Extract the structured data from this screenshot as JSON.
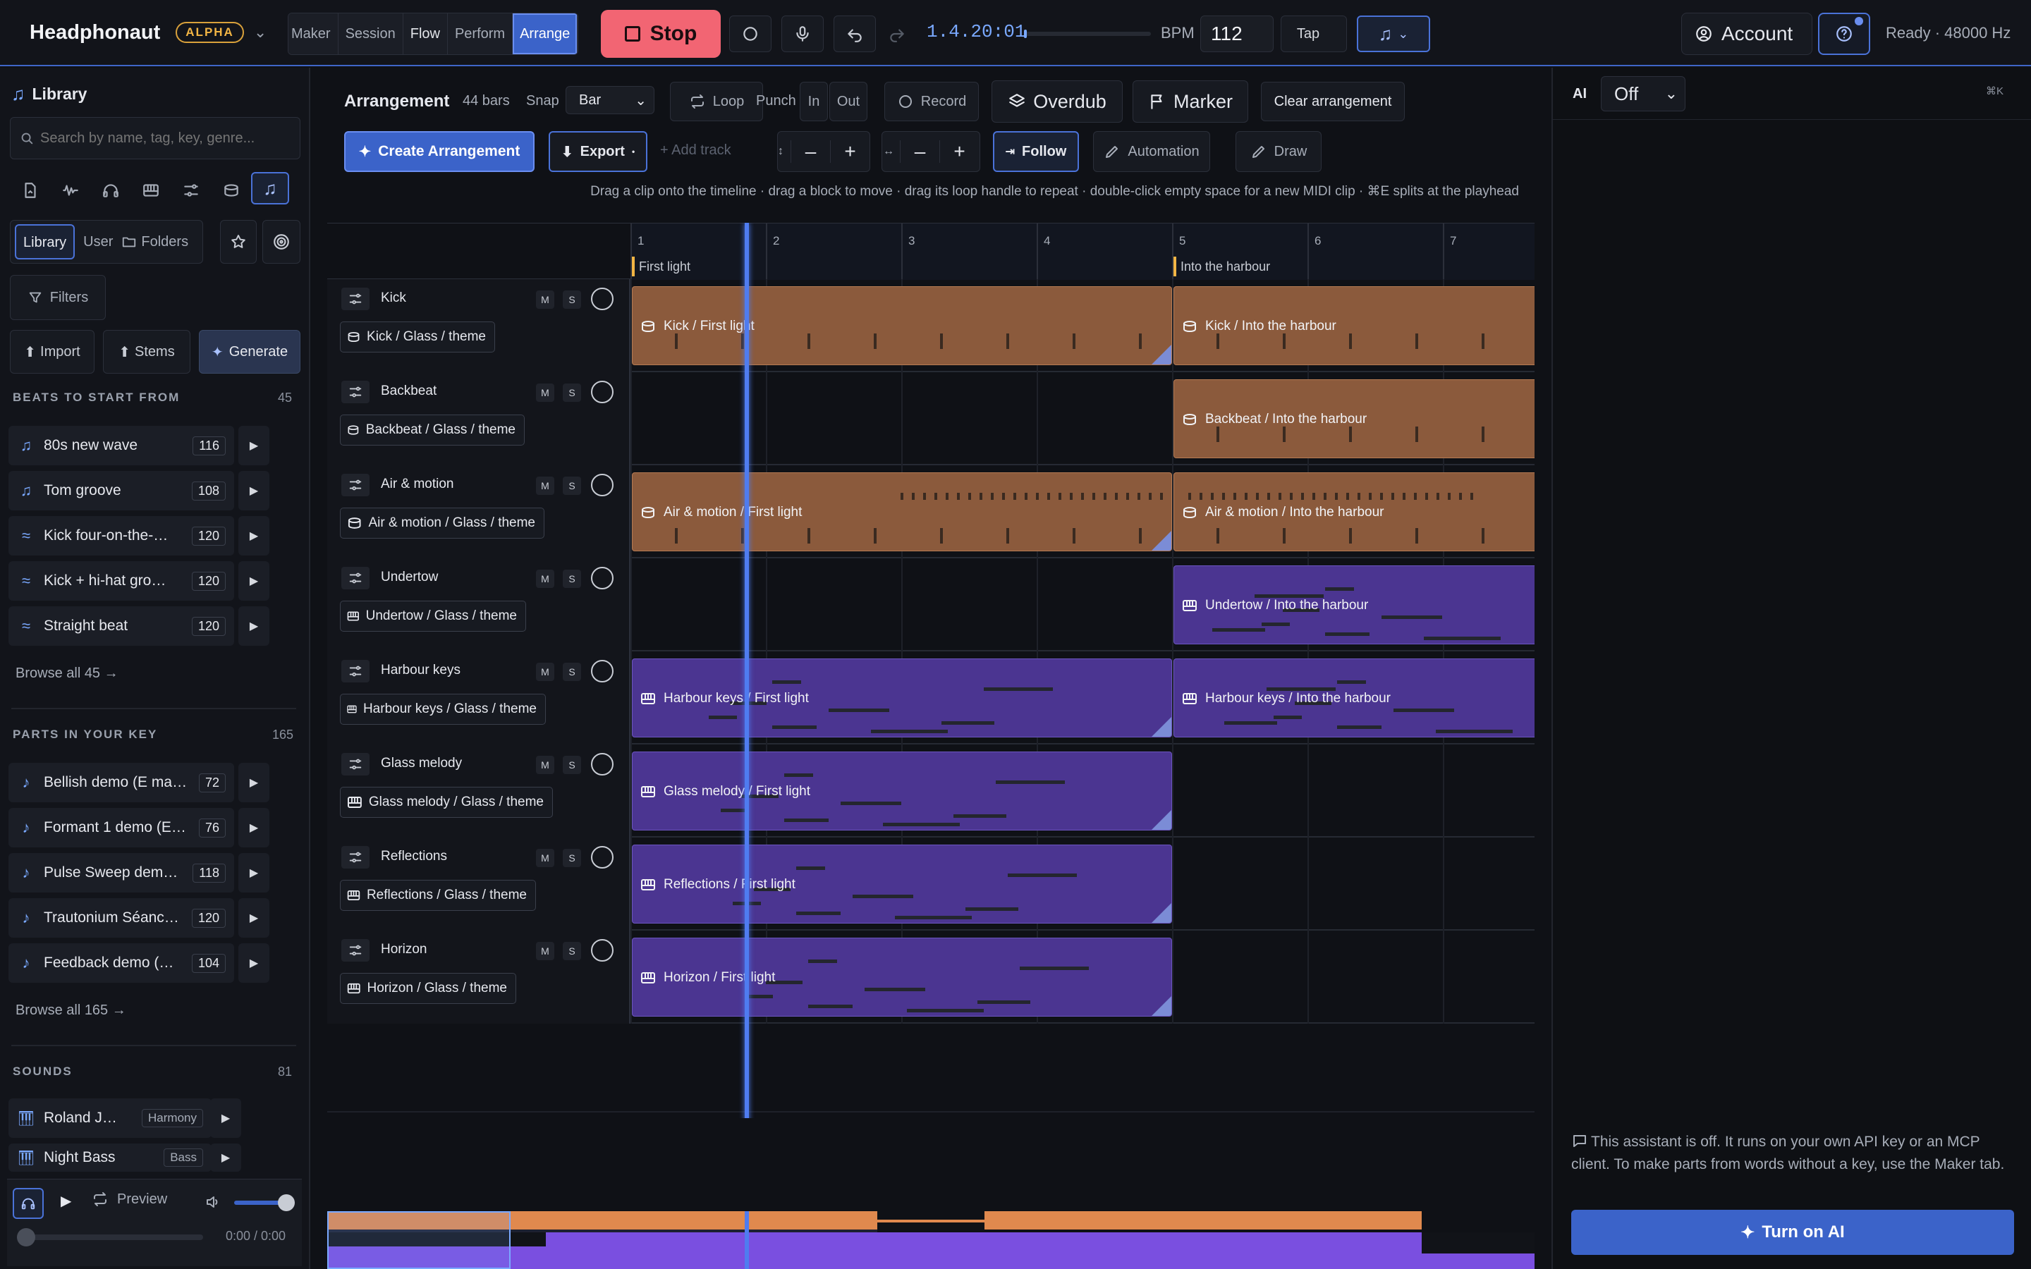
{
  "app": {
    "name": "Headphonaut",
    "badge": "ALPHA"
  },
  "modes": [
    "Maker",
    "Session",
    "Flow",
    "Perform",
    "Arrange"
  ],
  "active_mode": "Arrange",
  "transport": {
    "stop_label": "Stop",
    "timecode": "1.4.20:01",
    "bpm_label": "BPM",
    "bpm": "112",
    "tap_label": "Tap"
  },
  "account_label": "Account",
  "status": "Ready · 48000 Hz",
  "library": {
    "title": "Library",
    "search_placeholder": "Search by name, tag, key, genre...",
    "tabs": [
      "Library",
      "User",
      "Folders"
    ],
    "filters_label": "Filters",
    "import_label": "Import",
    "stems_label": "Stems",
    "generate_label": "Generate",
    "beats": {
      "title": "BEATS TO START FROM",
      "count": "45",
      "browse": "Browse all 45 →",
      "items": [
        {
          "name": "80s new wave",
          "bpm": "116",
          "icon": "note-icon"
        },
        {
          "name": "Tom groove",
          "bpm": "108",
          "icon": "note-icon"
        },
        {
          "name": "Kick four-on-the-…",
          "bpm": "120",
          "icon": "wave-icon"
        },
        {
          "name": "Kick + hi-hat gro…",
          "bpm": "120",
          "icon": "wave-icon"
        },
        {
          "name": "Straight beat",
          "bpm": "120",
          "icon": "wave-icon"
        }
      ]
    },
    "parts": {
      "title": "PARTS IN YOUR KEY",
      "count": "165",
      "browse": "Browse all 165 →",
      "items": [
        {
          "name": "Bellish demo (E ma…",
          "bpm": "72"
        },
        {
          "name": "Formant 1 demo (E…",
          "bpm": "76"
        },
        {
          "name": "Pulse Sweep dem…",
          "bpm": "118"
        },
        {
          "name": "Trautonium Séanc…",
          "bpm": "120"
        },
        {
          "name": "Feedback demo (…",
          "bpm": "104"
        }
      ]
    },
    "sounds": {
      "title": "SOUNDS",
      "count": "81",
      "items": [
        {
          "name": "Roland J…",
          "tag": "Harmony"
        },
        {
          "name": "Night Bass",
          "tag": "Bass"
        }
      ]
    },
    "preview_label": "Preview",
    "preview_time": "0:00 / 0:00"
  },
  "arrangement": {
    "title": "Arrangement",
    "bars": "44 bars",
    "snap_label": "Snap",
    "snap_value": "Bar",
    "loop_label": "Loop",
    "punch_label": "Punch",
    "in_label": "In",
    "out_label": "Out",
    "record_label": "Record",
    "overdub_label": "Overdub",
    "marker_label": "Marker",
    "clear_label": "Clear arrangement",
    "create_label": "Create Arrangement",
    "export_label": "Export",
    "add_track_label": "+ Add track",
    "follow_label": "Follow",
    "automation_label": "Automation",
    "draw_label": "Draw",
    "hint": "Drag a clip onto the timeline · drag a block to move · drag its loop handle to repeat · double-click empty space for a new MIDI clip · ⌘E splits at the playhead",
    "bar_numbers": [
      "1",
      "2",
      "3",
      "4",
      "5",
      "6",
      "7"
    ],
    "markers": [
      "First light",
      "Into the harbour"
    ],
    "tracks": [
      {
        "name": "Kick",
        "chip": "Kick / Glass / theme",
        "kind": "drum",
        "clips": [
          "Kick / First light",
          "Kick / Into the harbour"
        ]
      },
      {
        "name": "Backbeat",
        "chip": "Backbeat / Glass / theme",
        "kind": "drum",
        "clips": [
          "",
          "Backbeat / Into the harbour"
        ]
      },
      {
        "name": "Air & motion",
        "chip": "Air & motion / Glass / theme",
        "kind": "drum",
        "clips": [
          "Air & motion / First light",
          "Air & motion / Into the harbour"
        ]
      },
      {
        "name": "Undertow",
        "chip": "Undertow / Glass / theme",
        "kind": "keys",
        "clips": [
          "",
          "Undertow / Into the harbour"
        ]
      },
      {
        "name": "Harbour keys",
        "chip": "Harbour keys / Glass / theme",
        "kind": "keys",
        "clips": [
          "Harbour keys / First light",
          "Harbour keys / Into the harbour"
        ]
      },
      {
        "name": "Glass melody",
        "chip": "Glass melody / Glass / theme",
        "kind": "keys",
        "clips": [
          "Glass melody / First light",
          ""
        ]
      },
      {
        "name": "Reflections",
        "chip": "Reflections / Glass / theme",
        "kind": "keys",
        "clips": [
          "Reflections / First light",
          ""
        ]
      },
      {
        "name": "Horizon",
        "chip": "Horizon / Glass / theme",
        "kind": "keys",
        "clips": [
          "Horizon / First light",
          ""
        ]
      }
    ],
    "ms": {
      "m": "M",
      "s": "S"
    }
  },
  "ai": {
    "label": "AI",
    "mode": "Off",
    "shortcut": "⌘K",
    "message": "This assistant is off. It runs on your own API key or an MCP client. To make parts from words without a key, use the Maker tab.",
    "button": "Turn on AI"
  },
  "colors": {
    "accent": "#3b63c9",
    "stop": "#f26573",
    "drum_clip": "#8b5a3c",
    "midi_clip": "#4b3591",
    "playhead": "#4f7cf0"
  }
}
